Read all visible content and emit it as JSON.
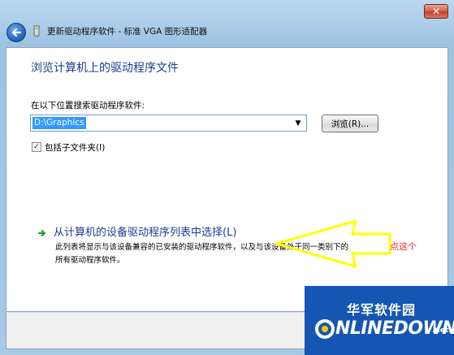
{
  "window": {
    "title": "更新驱动程序软件 - 标准 VGA 图形适配器",
    "close_label": "✕"
  },
  "content": {
    "heading": "浏览计算机上的驱动程序文件",
    "search_label": "在以下位置搜索驱动程序软件:",
    "path_value": "D:\\Graphics",
    "browse_label": "浏览(R)...",
    "include_subfolders_label": "包括子文件夹(I)",
    "include_subfolders_checked": true
  },
  "pick_list": {
    "title": "从计算机的设备驱动程序列表中选择(L)",
    "description_line1": "此列表将显示与该设备兼容的已安装的驱动程序软件，以及与该设备处于同一类别下的",
    "description_line2": "所有驱动程序软件。"
  },
  "annotation": {
    "text": "点这个",
    "color": "#ff2020",
    "arrow_color": "#ffff00"
  },
  "watermark": {
    "chinese": "华军软件园",
    "brand": "NLINEDOWN",
    "tld": ".net"
  },
  "icons": {
    "back": "back-arrow-icon",
    "window": "device-icon",
    "link": "green-arrow-icon",
    "dropdown": "dropdown-triangle-icon"
  }
}
